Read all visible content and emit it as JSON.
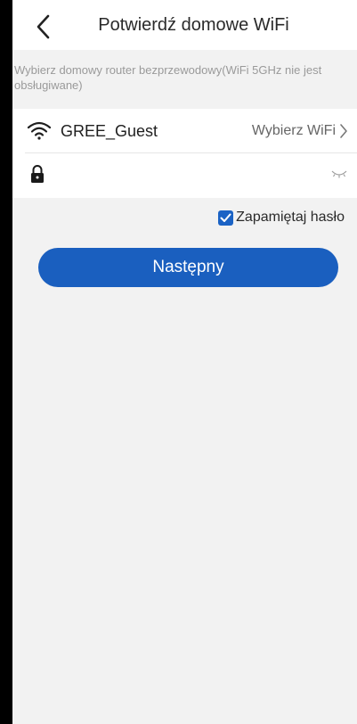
{
  "header": {
    "title": "Potwierdź domowe WiFi",
    "back_icon": "chevron-left-icon"
  },
  "hint": "Wybierz domowy router bezprzewodowy(WiFi 5GHz nie jest obsługiwane)",
  "wifi": {
    "icon": "wifi-icon",
    "ssid": "GREE_Guest",
    "choose_label": "Wybierz WiFi",
    "choose_icon": "chevron-right-icon"
  },
  "password": {
    "icon": "lock-icon",
    "value": "",
    "placeholder": "",
    "visibility_icon": "eye-closed-icon"
  },
  "remember": {
    "checked": true,
    "label": "Zapamiętaj hasło"
  },
  "next_button": {
    "label": "Następny"
  },
  "colors": {
    "accent": "#1a5fbf",
    "background": "#f2f2f2",
    "hint_text": "#9a9a9a"
  }
}
